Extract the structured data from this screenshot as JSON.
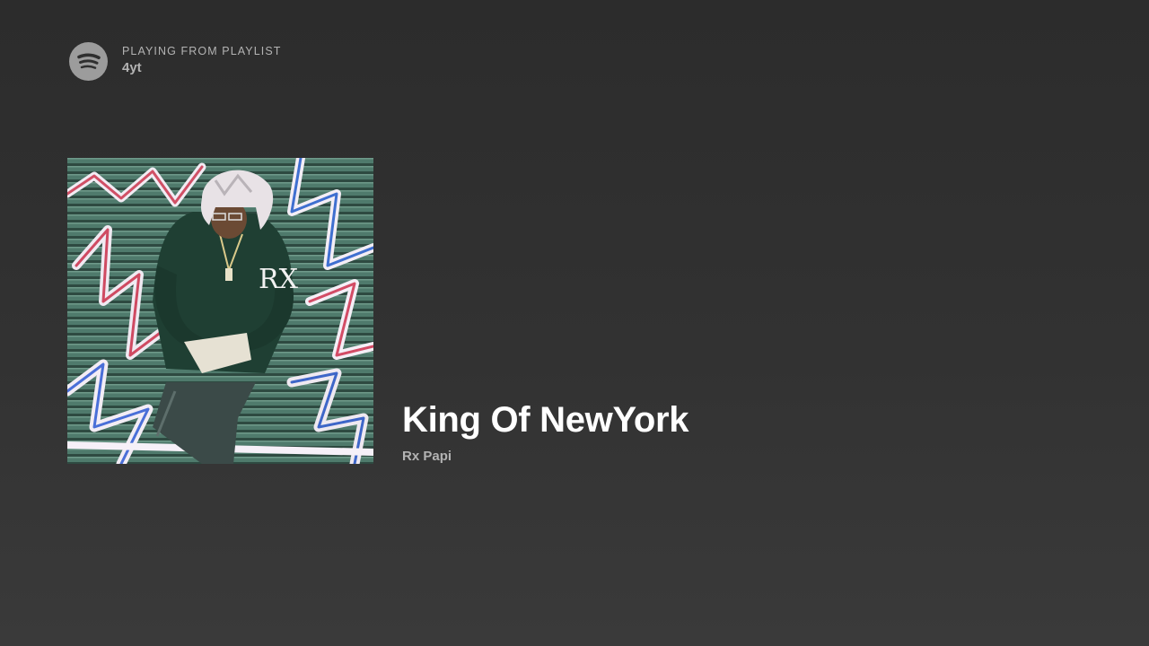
{
  "context": {
    "label": "PLAYING FROM PLAYLIST",
    "name": "4yt",
    "icon": "spotify-logo-icon"
  },
  "track": {
    "title": "King Of NewYork",
    "artist": "Rx Papi"
  },
  "cover": {
    "description_icon": "album-cover",
    "shirt_text": "RX"
  },
  "colors": {
    "background": "#2f2f2f",
    "primary_text": "#ffffff",
    "secondary_text": "#b3b3b3",
    "logo": "#9c9c9c"
  }
}
